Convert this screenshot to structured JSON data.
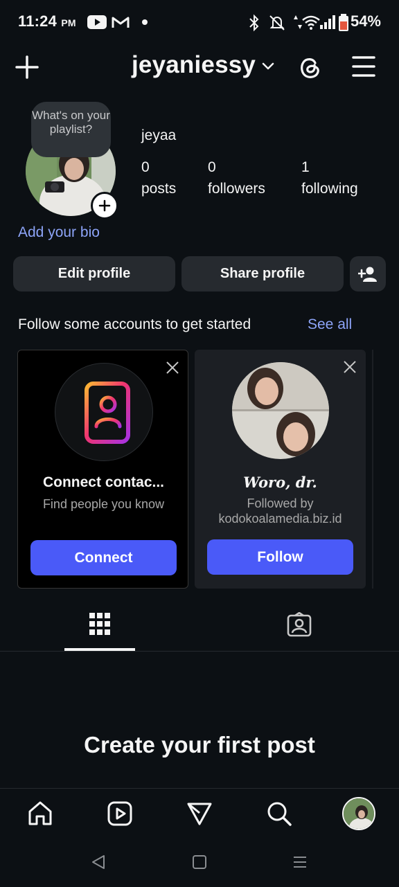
{
  "status_bar": {
    "time": "11:24",
    "ampm": "PM",
    "battery": "54%"
  },
  "header": {
    "username": "jeyaniessy"
  },
  "profile": {
    "bubble_text": "What's on your playlist?",
    "display_name": "jeyaa",
    "stats": [
      {
        "value": "0",
        "label": "posts"
      },
      {
        "value": "0",
        "label": "followers"
      },
      {
        "value": "1",
        "label": "following"
      }
    ],
    "add_bio": "Add your bio",
    "edit_profile": "Edit profile",
    "share_profile": "Share profile"
  },
  "suggestions": {
    "heading": "Follow some accounts to get started",
    "see_all": "See all",
    "cards": [
      {
        "title": "Connect contac...",
        "subtitle": "Find people you know",
        "button": "Connect"
      },
      {
        "title": "Woro, dr.",
        "subtitle": "Followed by kodokoalamedia.biz.id",
        "button": "Follow"
      }
    ]
  },
  "empty_state": {
    "title": "Create your first post"
  },
  "colors": {
    "background": "#0c1014",
    "accent_blue": "#4a5af8",
    "link_blue": "#8da4f8",
    "button_dark": "#262a2f"
  },
  "icons": [
    "play-icon",
    "gmail-icon",
    "bluetooth-icon",
    "mute-icon",
    "wifi-icon",
    "signal-icon",
    "battery-icon",
    "plus-icon",
    "chevron-down-icon",
    "threads-icon",
    "menu-icon",
    "add-person-icon",
    "close-icon",
    "contacts-icon",
    "grid-icon",
    "tagged-icon",
    "home-icon",
    "reels-icon",
    "send-icon",
    "search-icon",
    "back-icon",
    "square-icon",
    "lines-icon"
  ]
}
